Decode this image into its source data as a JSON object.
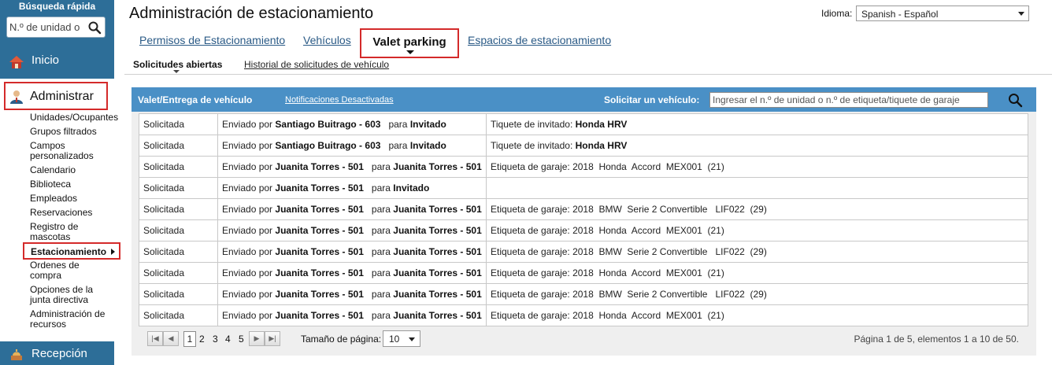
{
  "sidebar": {
    "quick_search": {
      "title": "Búsqueda rápida",
      "placeholder": "N.º de unidad o"
    },
    "inicio": "Inicio",
    "administrar": "Administrar",
    "items": [
      "Unidades/Ocupantes",
      "Grupos filtrados",
      "Campos personalizados",
      "Calendario",
      "Biblioteca",
      "Empleados",
      "Reservaciones",
      "Registro de mascotas",
      "Estacionamiento",
      "Ordenes de compra",
      "Opciones de la junta directiva",
      "Administración de recursos"
    ],
    "recepcion": "Recepción"
  },
  "header": {
    "title": "Administración de estacionamiento",
    "language_label": "Idioma:",
    "language_value": "Spanish - Español"
  },
  "tabs": [
    "Permisos de Estacionamiento",
    "Vehículos",
    "Valet parking",
    "Espacios de estacionamiento"
  ],
  "subtabs": [
    "Solicitudes abiertas",
    "Historial de solicitudes de vehículo"
  ],
  "panel": {
    "title": "Valet/Entrega de vehículo",
    "notifications": "Notificaciones Desactivadas",
    "request_label": "Solicitar un vehículo:",
    "request_placeholder": "Ingresar el n.º de unidad o n.º de etiqueta/tiquete de garaje"
  },
  "rows": [
    {
      "status": "Solicitada",
      "sent": "Enviado por",
      "by": "Santiago Buitrago - 603",
      "para": "para",
      "to": "Invitado",
      "vlabel": "Tiquete de invitado:",
      "vehicle": "Honda HRV"
    },
    {
      "status": "Solicitada",
      "sent": "Enviado por",
      "by": "Santiago Buitrago - 603",
      "para": "para",
      "to": "Invitado",
      "vlabel": "Tiquete de invitado:",
      "vehicle": "Honda HRV"
    },
    {
      "status": "Solicitada",
      "sent": "Enviado por",
      "by": "Juanita Torres - 501",
      "para": "para",
      "to": "Juanita Torres - 501",
      "vlabel": "Etiqueta de garaje: 2018  Honda  Accord  MEX001  (21)",
      "vehicle": ""
    },
    {
      "status": "Solicitada",
      "sent": "Enviado por",
      "by": "Juanita Torres - 501",
      "para": "para",
      "to": "Invitado",
      "vlabel": "",
      "vehicle": ""
    },
    {
      "status": "Solicitada",
      "sent": "Enviado por",
      "by": "Juanita Torres - 501",
      "para": "para",
      "to": "Juanita Torres - 501",
      "vlabel": "Etiqueta de garaje: 2018  BMW  Serie 2 Convertible   LIF022  (29)",
      "vehicle": ""
    },
    {
      "status": "Solicitada",
      "sent": "Enviado por",
      "by": "Juanita Torres - 501",
      "para": "para",
      "to": "Juanita Torres - 501",
      "vlabel": "Etiqueta de garaje: 2018  Honda  Accord  MEX001  (21)",
      "vehicle": ""
    },
    {
      "status": "Solicitada",
      "sent": "Enviado por",
      "by": "Juanita Torres - 501",
      "para": "para",
      "to": "Juanita Torres - 501",
      "vlabel": "Etiqueta de garaje: 2018  BMW  Serie 2 Convertible   LIF022  (29)",
      "vehicle": ""
    },
    {
      "status": "Solicitada",
      "sent": "Enviado por",
      "by": "Juanita Torres - 501",
      "para": "para",
      "to": "Juanita Torres - 501",
      "vlabel": "Etiqueta de garaje: 2018  Honda  Accord  MEX001  (21)",
      "vehicle": ""
    },
    {
      "status": "Solicitada",
      "sent": "Enviado por",
      "by": "Juanita Torres - 501",
      "para": "para",
      "to": "Juanita Torres - 501",
      "vlabel": "Etiqueta de garaje: 2018  BMW  Serie 2 Convertible   LIF022  (29)",
      "vehicle": ""
    },
    {
      "status": "Solicitada",
      "sent": "Enviado por",
      "by": "Juanita Torres - 501",
      "para": "para",
      "to": "Juanita Torres - 501",
      "vlabel": "Etiqueta de garaje: 2018  Honda  Accord  MEX001  (21)",
      "vehicle": ""
    }
  ],
  "pager": {
    "pages": [
      "1",
      "2",
      "3",
      "4",
      "5"
    ],
    "page_size_label": "Tamaño de página:",
    "page_size": "10",
    "info": "Página 1 de 5, elementos 1 a 10 de 50."
  },
  "colors": {
    "sidebar_blue": "#2d6e98",
    "panel_header": "#4a90c6",
    "highlight_red": "#d42a2a",
    "link_blue": "#2a5a86"
  }
}
